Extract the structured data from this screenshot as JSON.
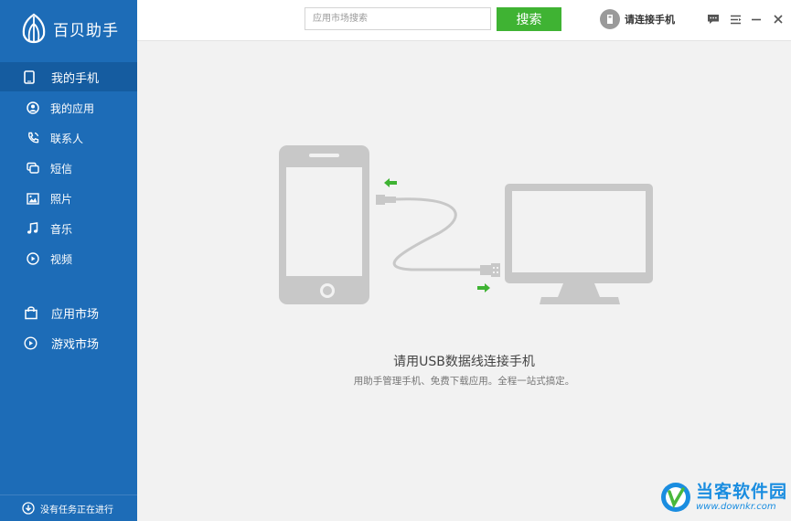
{
  "app": {
    "name": "百贝助手"
  },
  "sidebar": {
    "primary": {
      "label": "我的手机"
    },
    "sub_items": [
      {
        "label": "我的应用",
        "icon": "user-circle-icon"
      },
      {
        "label": "联系人",
        "icon": "phone-icon"
      },
      {
        "label": "短信",
        "icon": "message-icon"
      },
      {
        "label": "照片",
        "icon": "image-icon"
      },
      {
        "label": "音乐",
        "icon": "music-icon"
      },
      {
        "label": "视频",
        "icon": "play-circle-icon"
      }
    ],
    "markets": [
      {
        "label": "应用市场",
        "icon": "bag-icon"
      },
      {
        "label": "游戏市场",
        "icon": "play-circle-icon"
      }
    ],
    "status": "没有任务正在进行"
  },
  "topbar": {
    "search_placeholder": "应用市场搜索",
    "search_button": "搜索",
    "connect_label": "请连接手机"
  },
  "main": {
    "title": "请用USB数据线连接手机",
    "subtitle": "用助手管理手机、免费下载应用。全程一站式搞定。"
  },
  "watermark": {
    "name": "当客软件园",
    "url": "www.downkr.com"
  },
  "colors": {
    "sidebar": "#1d6cb7",
    "sidebar_active": "#155ca0",
    "accent_green": "#3fb333",
    "illustration_gray": "#c8c8c8"
  }
}
